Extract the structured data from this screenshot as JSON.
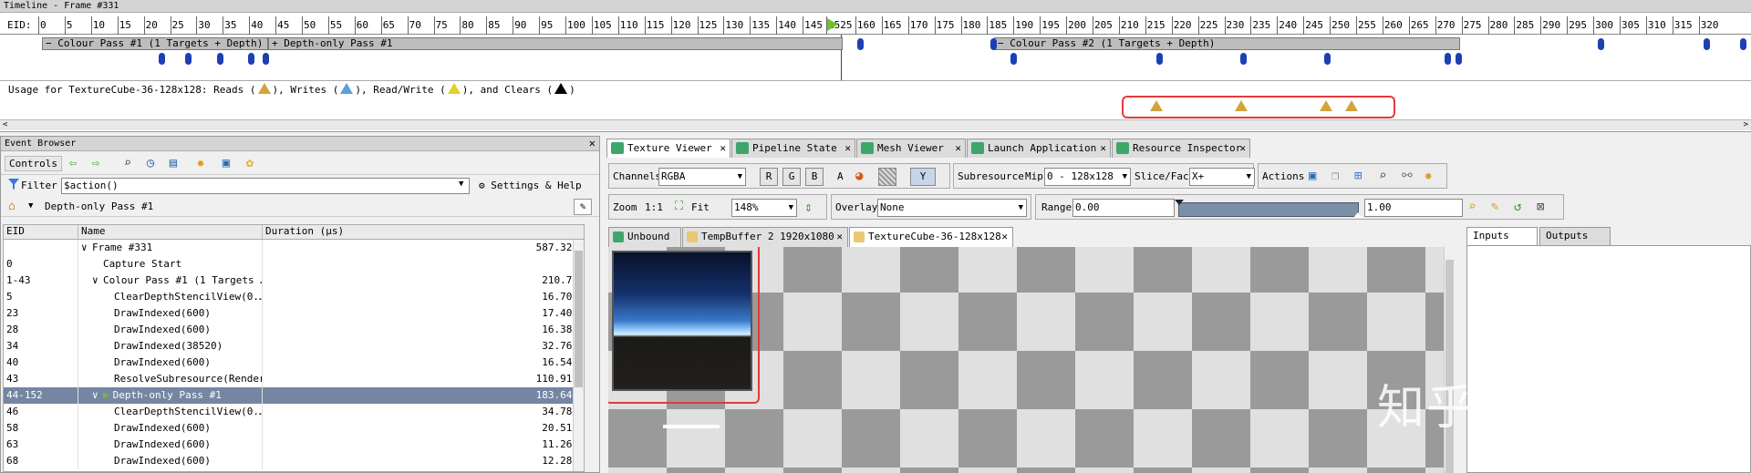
{
  "timeline": {
    "title": "Timeline - Frame #331",
    "eid_label": "EID:",
    "ticks": [
      "0",
      "5",
      "10",
      "15",
      "20",
      "25",
      "30",
      "35",
      "40",
      "45",
      "50",
      "55",
      "60",
      "65",
      "70",
      "75",
      "80",
      "85",
      "90",
      "95",
      "100",
      "105",
      "110",
      "115",
      "120",
      "125",
      "130",
      "135",
      "140",
      "145",
      "1525",
      "160",
      "165",
      "170",
      "175",
      "180",
      "185",
      "190",
      "195",
      "200",
      "205",
      "210",
      "215",
      "220",
      "225",
      "230",
      "235",
      "240",
      "245",
      "250",
      "255",
      "260",
      "265",
      "270",
      "275",
      "280",
      "285",
      "290",
      "295",
      "300",
      "305",
      "310",
      "315",
      "320"
    ],
    "passes": [
      {
        "label": "− Colour Pass #1 (1 Targets + Depth)"
      },
      {
        "label": "+ Depth-only Pass #1"
      },
      {
        "label": "− Colour Pass #2 (1 Targets + Depth)"
      }
    ],
    "usage_prefix": "Usage for TextureCube-36-128x128: Reads (",
    "usage_writes": "), Writes (",
    "usage_rw": "), Read/Write (",
    "usage_clears": "), and Clears (",
    "usage_end": ")",
    "colors": {
      "reads": "#d4a33c",
      "writes": "#5aa0e0",
      "rw": "#e0d02c",
      "clears": "#000000",
      "event_pill": "#1c3fb4",
      "highlight": "#e23a3a"
    }
  },
  "event_browser": {
    "title": "Event Browser",
    "controls_label": "Controls",
    "filter_label": "Filter",
    "filter_value": "$action()",
    "settings_label": "Settings & Help",
    "breadcrumb": "Depth-only Pass #1",
    "columns": [
      "EID",
      "Name",
      "Duration (µs)"
    ],
    "rows": [
      {
        "eid": "",
        "name": "Frame #331",
        "duration": "587.328",
        "indent": 0,
        "expander": "∨"
      },
      {
        "eid": "0",
        "name": "Capture Start",
        "duration": "",
        "indent": 1,
        "expander": ""
      },
      {
        "eid": "1-43",
        "name": "Colour Pass #1 (1 Targets …",
        "duration": "210.72",
        "indent": 1,
        "expander": "∨"
      },
      {
        "eid": "5",
        "name": "ClearDepthStencilView(0.…",
        "duration": "16.704",
        "indent": 2,
        "expander": ""
      },
      {
        "eid": "23",
        "name": "DrawIndexed(600)",
        "duration": "17.408",
        "indent": 2,
        "expander": ""
      },
      {
        "eid": "28",
        "name": "DrawIndexed(600)",
        "duration": "16.384",
        "indent": 2,
        "expander": ""
      },
      {
        "eid": "34",
        "name": "DrawIndexed(38520)",
        "duration": "32.768",
        "indent": 2,
        "expander": ""
      },
      {
        "eid": "40",
        "name": "DrawIndexed(600)",
        "duration": "16.544",
        "indent": 2,
        "expander": ""
      },
      {
        "eid": "43",
        "name": "ResolveSubresource(Render",
        "duration": "110.912",
        "indent": 2,
        "expander": ""
      },
      {
        "eid": "44-152",
        "name": "Depth-only Pass #1",
        "duration": "183.648",
        "indent": 1,
        "expander": "∨",
        "selected": true
      },
      {
        "eid": "46",
        "name": "ClearDepthStencilView(0.…",
        "duration": "34.784",
        "indent": 2,
        "expander": ""
      },
      {
        "eid": "58",
        "name": "DrawIndexed(600)",
        "duration": "20.512",
        "indent": 2,
        "expander": ""
      },
      {
        "eid": "63",
        "name": "DrawIndexed(600)",
        "duration": "11.264",
        "indent": 2,
        "expander": ""
      },
      {
        "eid": "68",
        "name": "DrawIndexed(600)",
        "duration": "12.288",
        "indent": 2,
        "expander": ""
      }
    ]
  },
  "docked_tabs": [
    {
      "label": "Texture Viewer",
      "active": true
    },
    {
      "label": "Pipeline State",
      "active": false
    },
    {
      "label": "Mesh Viewer",
      "active": false
    },
    {
      "label": "Launch Application",
      "active": false
    },
    {
      "label": "Resource Inspector",
      "active": false
    }
  ],
  "texture_viewer": {
    "channels_label": "Channels",
    "channels_value": "RGBA",
    "channel_buttons": [
      "R",
      "G",
      "B",
      "A"
    ],
    "y_button": "Y",
    "subresource_label": "Subresource",
    "mip_label": "Mip",
    "mip_value": "0 - 128x128",
    "slice_label": "Slice/Face",
    "slice_value": "X+",
    "actions_label": "Actions",
    "zoom_label": "Zoom",
    "zoom_11": "1:1",
    "fit_label": "Fit",
    "zoom_value": "148%",
    "overlay_label": "Overlay",
    "overlay_value": "None",
    "range_label": "Range",
    "range_min": "0.00",
    "range_max": "1.00",
    "texture_tabs": [
      {
        "label": "Unbound",
        "active": false
      },
      {
        "label": "TempBuffer 2 1920x1080",
        "active": false
      },
      {
        "label": "TextureCube-36-128x128",
        "active": true
      }
    ],
    "io_tabs": [
      "Inputs",
      "Outputs"
    ]
  },
  "watermark": "知乎 @新青年"
}
